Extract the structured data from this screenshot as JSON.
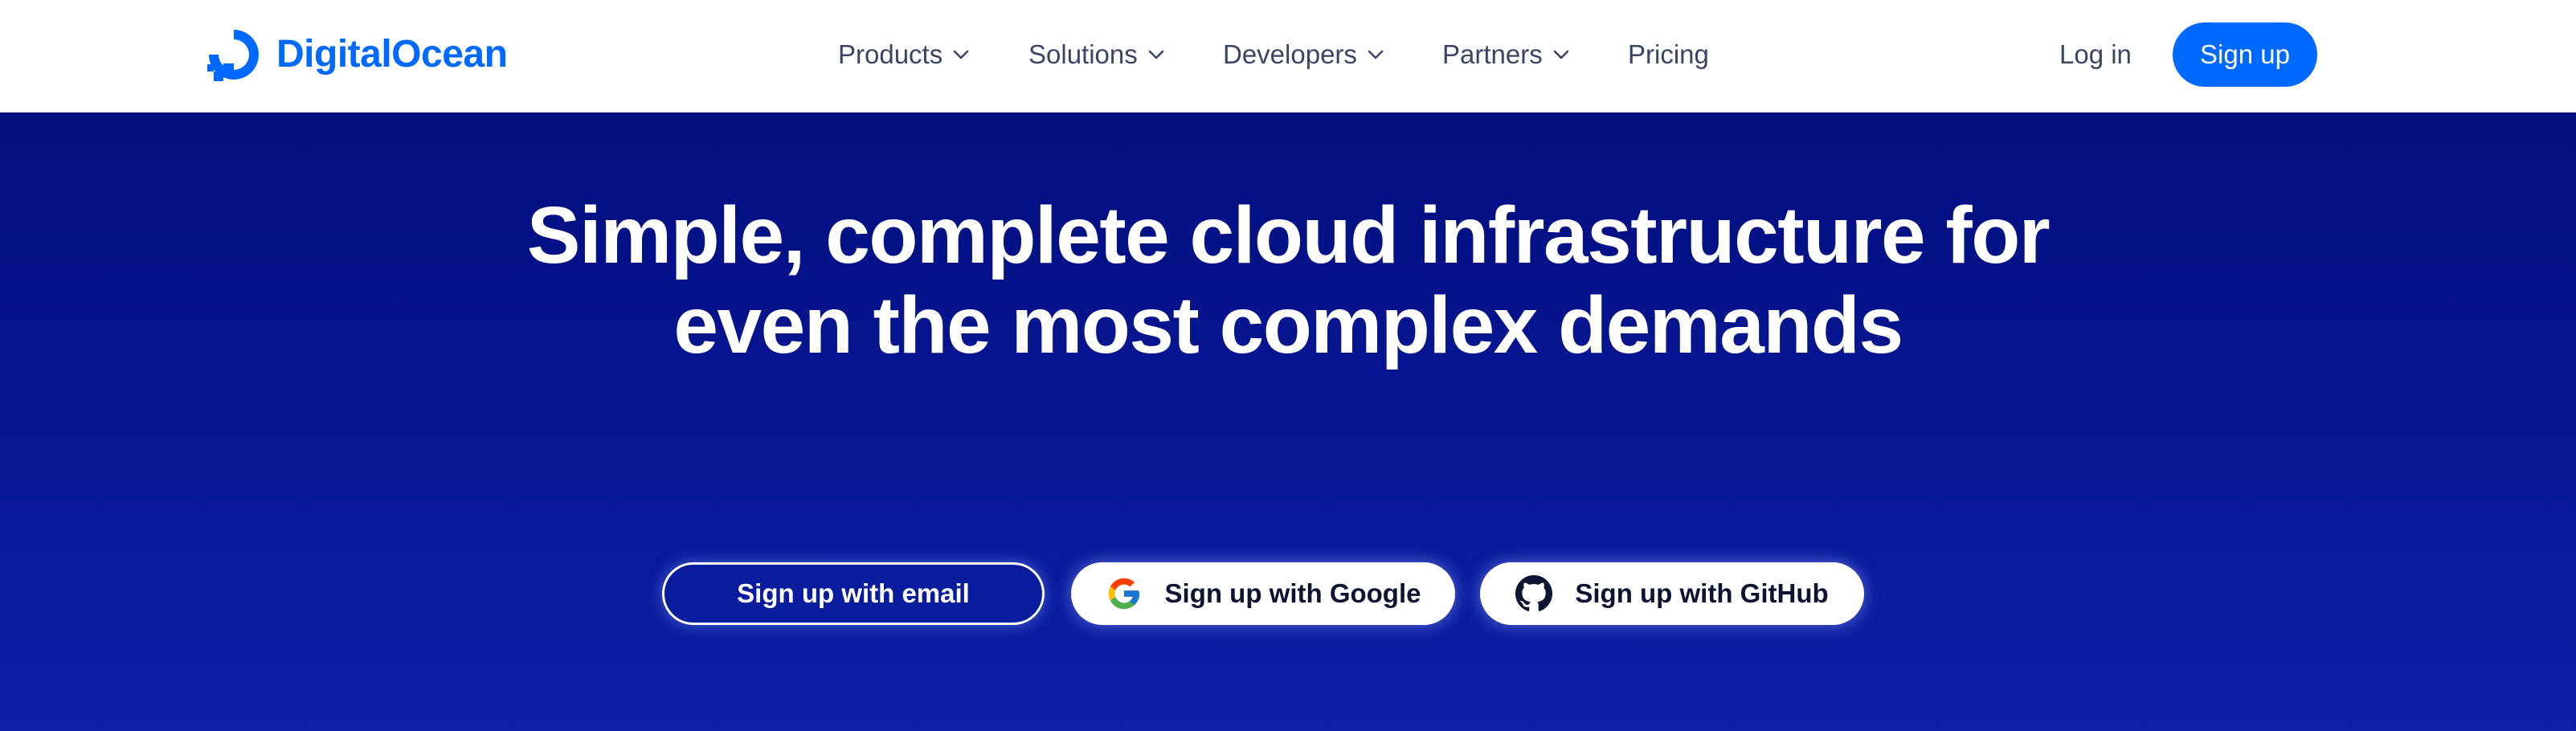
{
  "brand": {
    "name": "DigitalOcean",
    "color": "#0069ff",
    "logo_icon": "digitalocean-logo-icon"
  },
  "nav": {
    "items": [
      {
        "label": "Products",
        "has_dropdown": true
      },
      {
        "label": "Solutions",
        "has_dropdown": true
      },
      {
        "label": "Developers",
        "has_dropdown": true
      },
      {
        "label": "Partners",
        "has_dropdown": true
      },
      {
        "label": "Pricing",
        "has_dropdown": false
      }
    ],
    "login_label": "Log in",
    "signup_label": "Sign up"
  },
  "hero": {
    "headline_line1": "Simple, complete cloud infrastructure for",
    "headline_line2": "even the most complex demands",
    "background_top": "#020f7d",
    "background_bottom": "#0c21a6",
    "cta": {
      "email_label": "Sign up with email",
      "google_label": "Sign up with Google",
      "google_icon": "google-icon",
      "github_label": "Sign up with GitHub",
      "github_icon": "github-icon"
    }
  }
}
